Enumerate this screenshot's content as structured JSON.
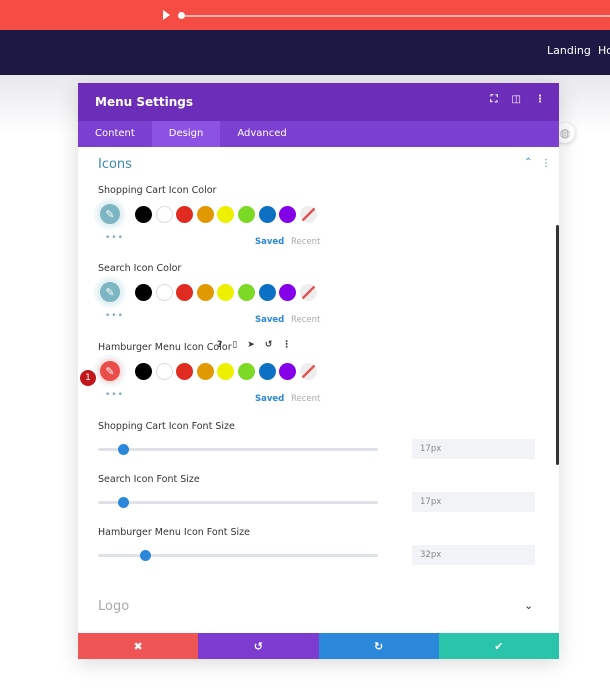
{
  "topbar": {
    "play_icon": "play-icon"
  },
  "nav": {
    "items": [
      "Landing",
      "Ho"
    ]
  },
  "panel": {
    "title": "Menu Settings",
    "tabs": [
      {
        "label": "Content"
      },
      {
        "label": "Design",
        "active": true
      },
      {
        "label": "Advanced"
      }
    ],
    "section_icons": "Icons",
    "section_logo": "Logo",
    "swatch_colors": [
      "#000000",
      "#ffffff",
      "#e02b20",
      "#e09900",
      "#edf000",
      "#7cda24",
      "#0c71c3",
      "#8300e9"
    ],
    "color_fields": [
      {
        "label": "Shopping Cart Icon Color",
        "saved": "Saved",
        "recent": "Recent"
      },
      {
        "label": "Search Icon Color",
        "saved": "Saved",
        "recent": "Recent"
      },
      {
        "label": "Hamburger Menu Icon Color",
        "saved": "Saved",
        "recent": "Recent",
        "badge": "1"
      }
    ],
    "sliders": [
      {
        "label": "Shopping Cart Icon Font Size",
        "value": "17px",
        "level": 17
      },
      {
        "label": "Search Icon Font Size",
        "value": "17px",
        "level": 17
      },
      {
        "label": "Hamburger Menu Icon Font Size",
        "value": "32px",
        "level": 32
      }
    ],
    "footer": {
      "cancel": "✖",
      "undo": "↺",
      "redo": "↻",
      "save": "✔"
    }
  }
}
